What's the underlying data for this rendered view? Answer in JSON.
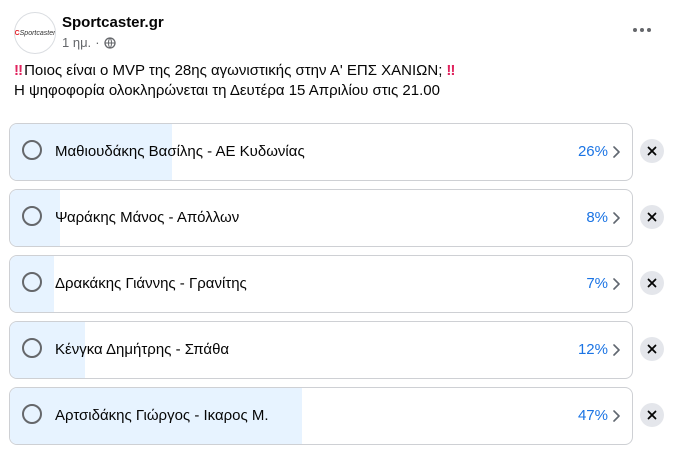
{
  "header": {
    "page_name": "Sportcaster.gr",
    "time_ago": "1 ημ.",
    "separator": "·",
    "avatar_logo": "Sportcaster",
    "privacy_icon": "globe-icon",
    "more_icon": "ellipsis-icon"
  },
  "post": {
    "line1": "Ποιος είναι ο MVP της 28ης αγωνιστικής στην Α' ΕΠΣ ΧΑΝΙΩΝ;",
    "line2": "Η ψηφοφορία ολοκληρώνεται τη Δευτέρα 15 Απριλίου στις 21.00",
    "emoji": "‼"
  },
  "poll": {
    "options": [
      {
        "label": "Μαθιουδάκης Βασίλης - ΑΕ Κυδωνίας",
        "percent_text": "26%",
        "percent": 26
      },
      {
        "label": "Ψαράκης Μάνος - Απόλλων",
        "percent_text": "8%",
        "percent": 8
      },
      {
        "label": "Δρακάκης Γιάννης - Γρανίτης",
        "percent_text": "7%",
        "percent": 7
      },
      {
        "label": "Κένγκα Δημήτρης - Σπάθα",
        "percent_text": "12%",
        "percent": 12
      },
      {
        "label": "Αρτσιδάκης Γιώργος - Ικαρος Μ.",
        "percent_text": "47%",
        "percent": 47
      }
    ]
  },
  "colors": {
    "accent": "#1b74e4",
    "fill": "#e7f3ff",
    "border": "#ced0d4",
    "emoji_red": "#e0245e"
  }
}
